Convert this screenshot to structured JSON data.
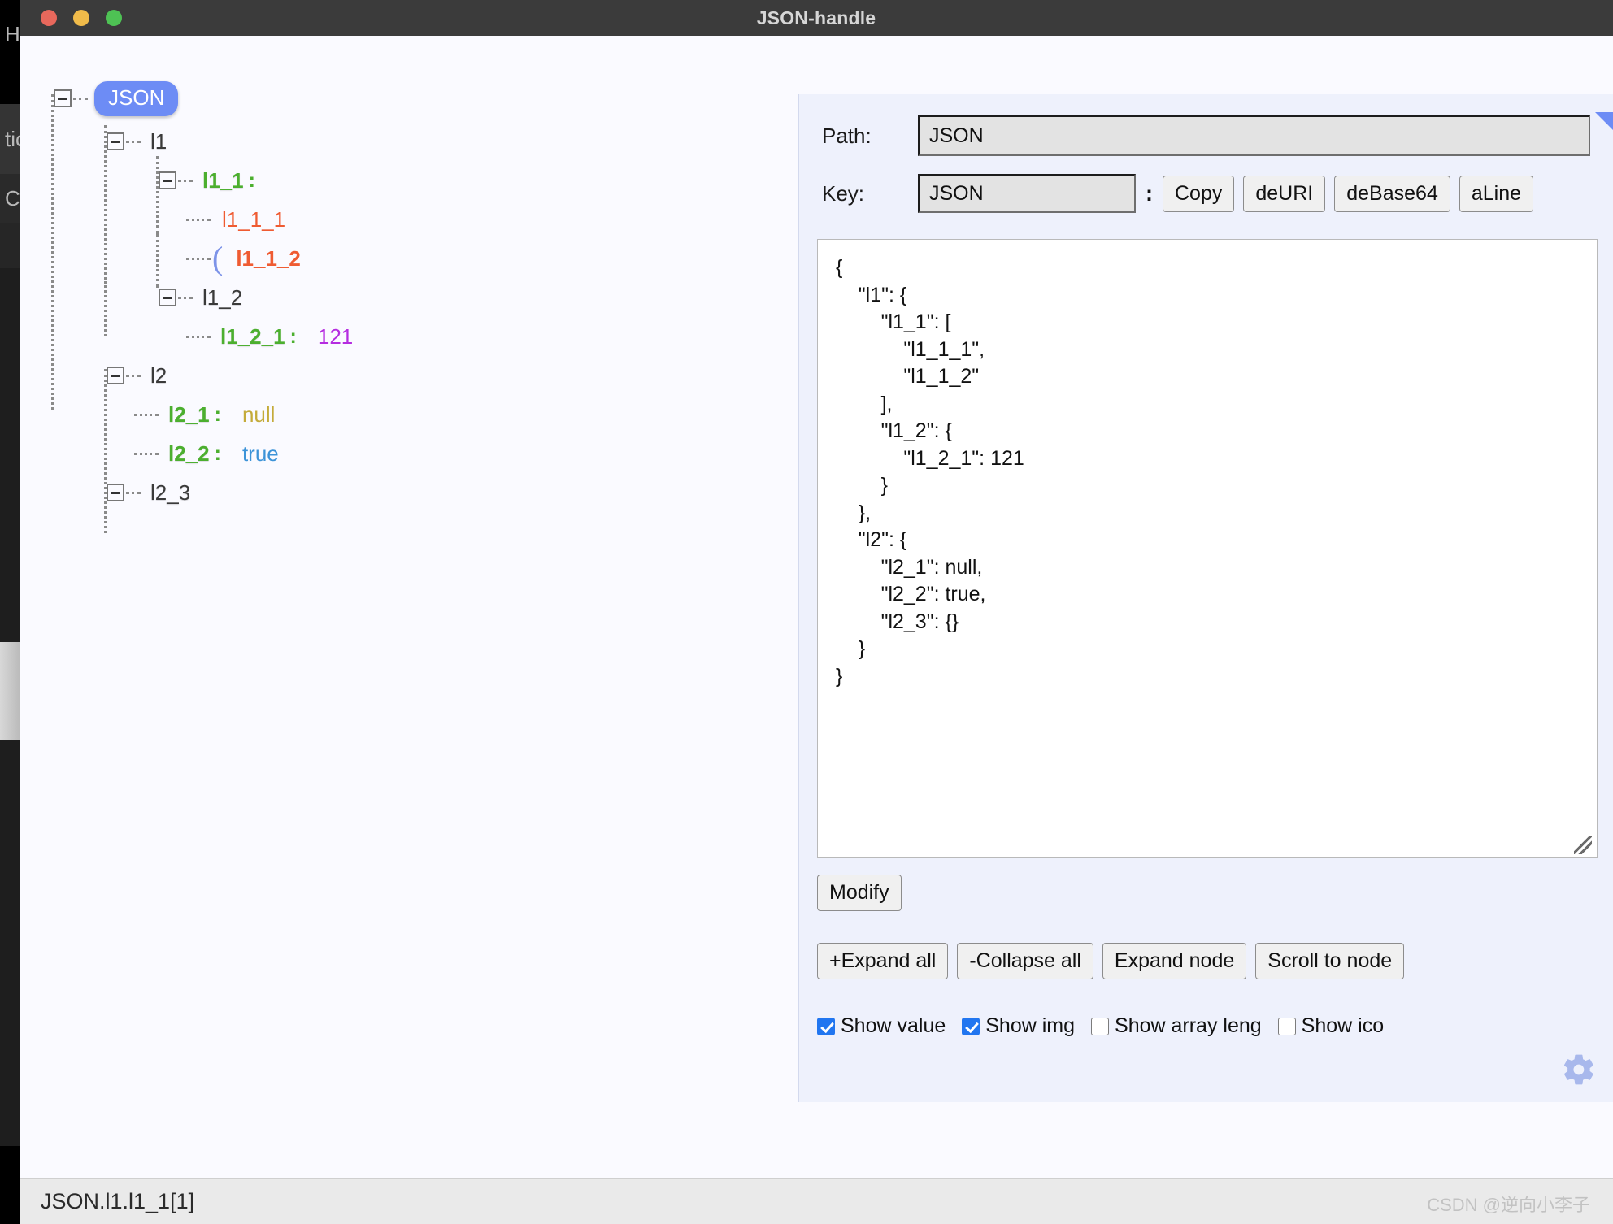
{
  "window": {
    "title": "JSON-handle",
    "traffic_lights": [
      "close",
      "minimize",
      "maximize"
    ]
  },
  "background_window": {
    "fragments": [
      "H",
      "tic",
      "Co"
    ]
  },
  "tree": {
    "root_label": "JSON",
    "nodes": [
      {
        "label": "l1",
        "kind": "object-key"
      },
      {
        "label": "l1_1",
        "kind": "array-key",
        "colon": ":"
      },
      {
        "label": "l1_1_1",
        "kind": "array-item",
        "selected": false
      },
      {
        "label": "l1_1_2",
        "kind": "array-item",
        "selected": true
      },
      {
        "label": "l1_2",
        "kind": "object-key"
      },
      {
        "label": "l1_2_1",
        "kind": "leaf",
        "colon": ":",
        "value": "121",
        "value_type": "number"
      },
      {
        "label": "l2",
        "kind": "object-key"
      },
      {
        "label": "l2_1",
        "kind": "leaf",
        "colon": ":",
        "value": "null",
        "value_type": "null"
      },
      {
        "label": "l2_2",
        "kind": "leaf",
        "colon": ":",
        "value": "true",
        "value_type": "boolean"
      },
      {
        "label": "l2_3",
        "kind": "object-key"
      }
    ]
  },
  "panel": {
    "path": {
      "label": "Path:",
      "value": "JSON",
      "placeholder": "Path"
    },
    "key": {
      "label": "Key:",
      "value": "JSON",
      "placeholder": "Key",
      "separator": ":"
    },
    "key_buttons": [
      "Copy",
      "deURI",
      "deBase64",
      "aLine"
    ],
    "json_text": "{\n    \"l1\": {\n        \"l1_1\": [\n            \"l1_1_1\",\n            \"l1_1_2\"\n        ],\n        \"l1_2\": {\n            \"l1_2_1\": 121\n        }\n    },\n    \"l2\": {\n        \"l2_1\": null,\n        \"l2_2\": true,\n        \"l2_3\": {}\n    }\n}",
    "modify_label": "Modify",
    "node_buttons": [
      "+Expand all",
      "-Collapse all",
      "Expand node",
      "Scroll to node"
    ],
    "checkboxes": [
      {
        "label": "Show value",
        "checked": true
      },
      {
        "label": "Show img",
        "checked": true
      },
      {
        "label": "Show array leng",
        "checked": false
      },
      {
        "label": "Show ico",
        "checked": false
      }
    ]
  },
  "statusbar": {
    "path": "JSON.l1.l1_1[1]",
    "watermark": "CSDN @逆向小李子"
  },
  "colors": {
    "accent": "#6d8cf5",
    "key_green": "#4caf2f",
    "number_purple": "#b52ce0",
    "null_olive": "#c4ab3a",
    "bool_blue": "#3c93d8",
    "array_orange": "#ef5b32",
    "titlebar": "#3b3b3b",
    "panel_bg": "#eef1fc"
  }
}
